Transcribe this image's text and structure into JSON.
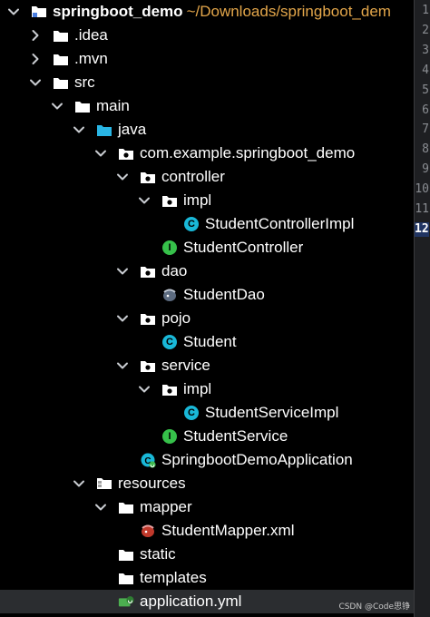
{
  "project": {
    "name": "springboot_demo",
    "path": "~/Downloads/springboot_dem"
  },
  "tree": [
    {
      "label": "springboot_demo",
      "icon": "project-folder-icon",
      "level": 0,
      "arrow": "down",
      "bold": true
    },
    {
      "label": ".idea",
      "icon": "folder-icon",
      "level": 1,
      "arrow": "right"
    },
    {
      "label": ".mvn",
      "icon": "folder-icon",
      "level": 1,
      "arrow": "right"
    },
    {
      "label": "src",
      "icon": "folder-icon",
      "level": 1,
      "arrow": "down"
    },
    {
      "label": "main",
      "icon": "folder-icon",
      "level": 2,
      "arrow": "down"
    },
    {
      "label": "java",
      "icon": "source-folder-icon",
      "level": 3,
      "arrow": "down"
    },
    {
      "label": "com.example.springboot_demo",
      "icon": "package-icon",
      "level": 4,
      "arrow": "down"
    },
    {
      "label": "controller",
      "icon": "package-icon",
      "level": 5,
      "arrow": "down"
    },
    {
      "label": "impl",
      "icon": "package-icon",
      "level": 6,
      "arrow": "down"
    },
    {
      "label": "StudentControllerImpl",
      "icon": "class-icon",
      "level": 7,
      "arrow": "none"
    },
    {
      "label": "StudentController",
      "icon": "interface-icon",
      "level": 6,
      "arrow": "none"
    },
    {
      "label": "dao",
      "icon": "package-icon",
      "level": 5,
      "arrow": "down"
    },
    {
      "label": "StudentDao",
      "icon": "mybatis-icon",
      "level": 6,
      "arrow": "none"
    },
    {
      "label": "pojo",
      "icon": "package-icon",
      "level": 5,
      "arrow": "down"
    },
    {
      "label": "Student",
      "icon": "class-icon",
      "level": 6,
      "arrow": "none"
    },
    {
      "label": "service",
      "icon": "package-icon",
      "level": 5,
      "arrow": "down"
    },
    {
      "label": "impl",
      "icon": "package-icon",
      "level": 6,
      "arrow": "down"
    },
    {
      "label": "StudentServiceImpl",
      "icon": "class-icon",
      "level": 7,
      "arrow": "none"
    },
    {
      "label": "StudentService",
      "icon": "interface-icon",
      "level": 6,
      "arrow": "none"
    },
    {
      "label": "SpringbootDemoApplication",
      "icon": "spring-boot-class-icon",
      "level": 5,
      "arrow": "none"
    },
    {
      "label": "resources",
      "icon": "resources-folder-icon",
      "level": 3,
      "arrow": "down"
    },
    {
      "label": "mapper",
      "icon": "folder-icon",
      "level": 4,
      "arrow": "down"
    },
    {
      "label": "StudentMapper.xml",
      "icon": "mybatis-xml-icon",
      "level": 5,
      "arrow": "none"
    },
    {
      "label": "static",
      "icon": "folder-icon",
      "level": 4,
      "arrow": "none"
    },
    {
      "label": "templates",
      "icon": "folder-icon",
      "level": 4,
      "arrow": "none"
    },
    {
      "label": "application.yml",
      "icon": "spring-yml-icon",
      "level": 4,
      "arrow": "none",
      "selected": true
    }
  ],
  "gutter": {
    "line_numbers": [
      "1",
      "2",
      "3",
      "4",
      "5",
      "6",
      "7",
      "8",
      "9",
      "10",
      "11",
      "12"
    ],
    "active": "12"
  },
  "watermark": "CSDN @Code思铮"
}
